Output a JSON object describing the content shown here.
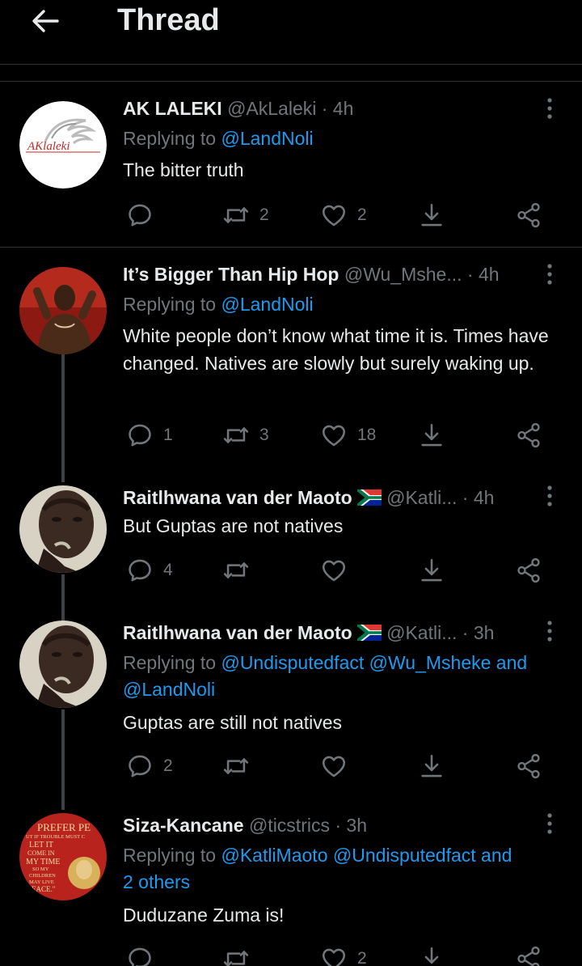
{
  "header": {
    "title": "Thread"
  },
  "tweets": [
    {
      "name": "AK LALEKI",
      "handle": "@AkLaleki",
      "time": "· 4h",
      "replying_prefix": "Replying to",
      "replying_to": "@LandNoli",
      "text": "The bitter truth",
      "avatar_text": "AKlaleki",
      "replies": "",
      "retweets": "2",
      "likes": "2"
    },
    {
      "name": "It’s Bigger Than Hip Hop",
      "handle": "@Wu_Mshe...",
      "time": "· 4h",
      "replying_prefix": "Replying to",
      "replying_to": "@LandNoli",
      "text": "White people don’t know what time it is. Times have changed. Natives are slowly but surely waking up.",
      "replies": "1",
      "retweets": "3",
      "likes": "18"
    },
    {
      "name": "Raitlhwana van der Maoto",
      "handle": "@Katli...",
      "time": "· 4h",
      "text": "But Guptas are not natives",
      "replies": "4",
      "retweets": "",
      "likes": ""
    },
    {
      "name": "Raitlhwana van der Maoto",
      "handle": "@Katli...",
      "time": "· 3h",
      "replying_prefix": "Replying to",
      "replying_to_line1": "@Undisputedfact @Wu_Msheke and",
      "replying_to_line2": "@LandNoli",
      "text": "Guptas are still not natives",
      "replies": "2",
      "retweets": "",
      "likes": ""
    },
    {
      "name": "Siza-Kancane",
      "handle": "@ticstrics",
      "time": "· 3h",
      "replying_prefix": "Replying to",
      "replying_to_line1": "@KatliMaoto @Undisputedfact and",
      "replying_to_line2": "2 others",
      "text": "Duduzane Zuma is!",
      "avatar_lines": [
        "PREFER PE",
        "UT IF TROUBLE MUST C",
        "LET IT",
        "COME IN",
        "MY TIME",
        "SO MY",
        "CHILDREN",
        "MAY LIVE",
        "PEACE.\""
      ],
      "replies": "",
      "retweets": "",
      "likes": "2"
    }
  ],
  "colors": {
    "background": "#000000",
    "text": "#e7e9ea",
    "muted": "#71767b",
    "link": "#1d9bf0",
    "divider": "#2f3336"
  },
  "icons": [
    "back-arrow-icon",
    "more-icon",
    "reply-icon",
    "retweet-icon",
    "like-icon",
    "download-icon",
    "share-icon",
    "south-africa-flag-icon"
  ]
}
